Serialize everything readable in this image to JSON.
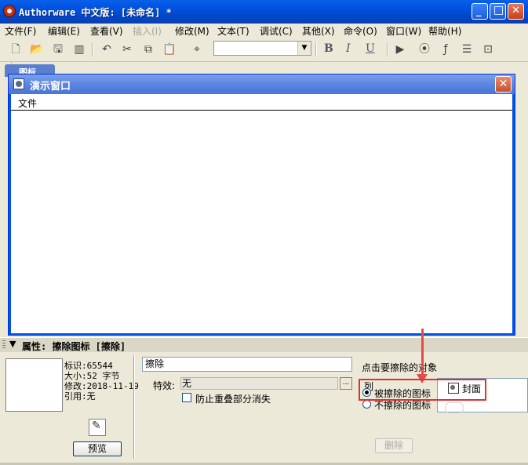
{
  "app": {
    "title": "Authorware 中文版: [未命名] *"
  },
  "titlebar": {
    "min_glyph": "_",
    "max_glyph": "□",
    "close_glyph": "✕"
  },
  "menu": {
    "items": [
      {
        "label": "文件(F)",
        "enabled": true
      },
      {
        "label": "编辑(E)",
        "enabled": true
      },
      {
        "label": "查看(V)",
        "enabled": true
      },
      {
        "label": "插入(I)",
        "enabled": false
      },
      {
        "label": "修改(M)",
        "enabled": true
      },
      {
        "label": "文本(T)",
        "enabled": true
      },
      {
        "label": "调试(C)",
        "enabled": true
      },
      {
        "label": "其他(X)",
        "enabled": true
      },
      {
        "label": "命令(O)",
        "enabled": true
      },
      {
        "label": "窗口(W)",
        "enabled": true
      },
      {
        "label": "帮助(H)",
        "enabled": true
      }
    ]
  },
  "toolbar": {
    "icons": [
      "new-icon",
      "open-icon",
      "save-all-icon",
      "import-icon",
      "undo-icon",
      "cut-icon",
      "copy-icon",
      "paste-icon",
      "find-icon"
    ],
    "font_combo_value": "",
    "bold": "B",
    "italic": "I",
    "underline": "U",
    "right_icons": [
      "run-icon",
      "control-panel-icon",
      "function-icon",
      "variable-icon",
      "knowledge-object-icon"
    ]
  },
  "background_window": {
    "tab_label": "图标"
  },
  "presentation_window": {
    "title": "演示窗口",
    "menu_label": "文件",
    "close_glyph": "✕"
  },
  "properties": {
    "header": "属性: 擦除图标 [擦除]",
    "info": {
      "id_line": "标识:65544",
      "size_line": "大小:52 字节",
      "modified_line": "修改:2018-11-19",
      "ref_line": "引用:无"
    },
    "preview_button": "预览",
    "name_value": "擦除",
    "effect_label": "特效:",
    "effect_value": "无",
    "effect_button": "...",
    "prevent_overlap_label": "防止重叠部分消失",
    "prevent_overlap_checked": false,
    "click_hint": "点击要擦除的对象",
    "list_label": "列",
    "radio_erase": "被擦除的图标",
    "radio_keep": "不擦除的图标",
    "selected_radio": "erase",
    "icon_list": [
      {
        "label": "封面",
        "icon": "display-icon"
      }
    ],
    "delete_button": "删除"
  },
  "annotation": {
    "highlight_color": "#e03030"
  }
}
